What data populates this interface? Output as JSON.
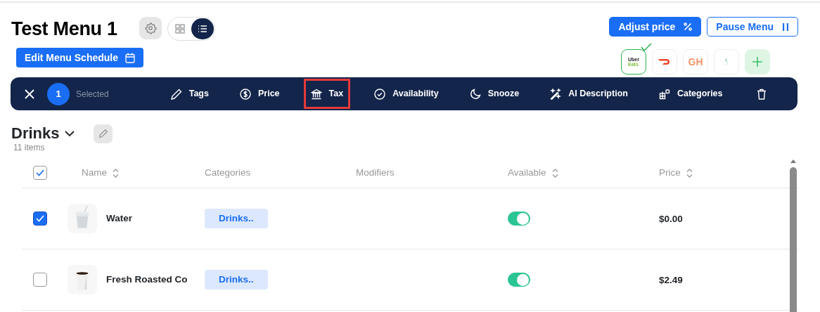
{
  "header": {
    "title": "Test Menu 1",
    "view_modes": [
      {
        "kind": "grid",
        "selected": false
      },
      {
        "kind": "list",
        "selected": true
      }
    ],
    "schedule_button": {
      "label": "Edit Menu Schedule"
    },
    "buttons": [
      {
        "label": "Adjust price",
        "kind": "primary"
      },
      {
        "label": "Pause Menu",
        "kind": "outline"
      }
    ],
    "platforms": [
      {
        "kind": "ubereats",
        "logo_lines": [
          "Uber",
          "Eats"
        ],
        "selected": true
      },
      {
        "kind": "doordash",
        "selected": false
      },
      {
        "kind": "grubhub",
        "logo_lines": [
          "GH"
        ],
        "selected": false
      },
      {
        "kind": "other",
        "selected": false
      },
      {
        "kind": "add",
        "selected": false
      }
    ]
  },
  "action_bar": {
    "count": "1",
    "count_label": "Selected",
    "actions": [
      {
        "label": "Tags",
        "highlighted": false
      },
      {
        "label": "Price",
        "highlighted": false
      },
      {
        "label": "Tax",
        "highlighted": true
      },
      {
        "label": "Availability",
        "highlighted": false
      },
      {
        "label": "Snooze",
        "highlighted": false
      },
      {
        "label": "AI Description",
        "highlighted": false
      },
      {
        "label": "Categories",
        "highlighted": false
      }
    ]
  },
  "section": {
    "title": "Drinks",
    "count": "11 items"
  },
  "table": {
    "select_all": {
      "checked": true
    },
    "columns": [
      {
        "label": "Name",
        "sortable": true
      },
      {
        "label": "Categories",
        "sortable": false
      },
      {
        "label": "Modifiers",
        "sortable": false
      },
      {
        "label": "Available",
        "sortable": true
      },
      {
        "label": "Price",
        "sortable": true
      }
    ],
    "rows": [
      {
        "name": "Water",
        "selected": true,
        "category": "Drinks..",
        "available": true,
        "price": "$0.00"
      },
      {
        "name": "Fresh Roasted Co",
        "selected": false,
        "category": "Drinks..",
        "available": true,
        "price": "$2.49"
      }
    ]
  }
}
